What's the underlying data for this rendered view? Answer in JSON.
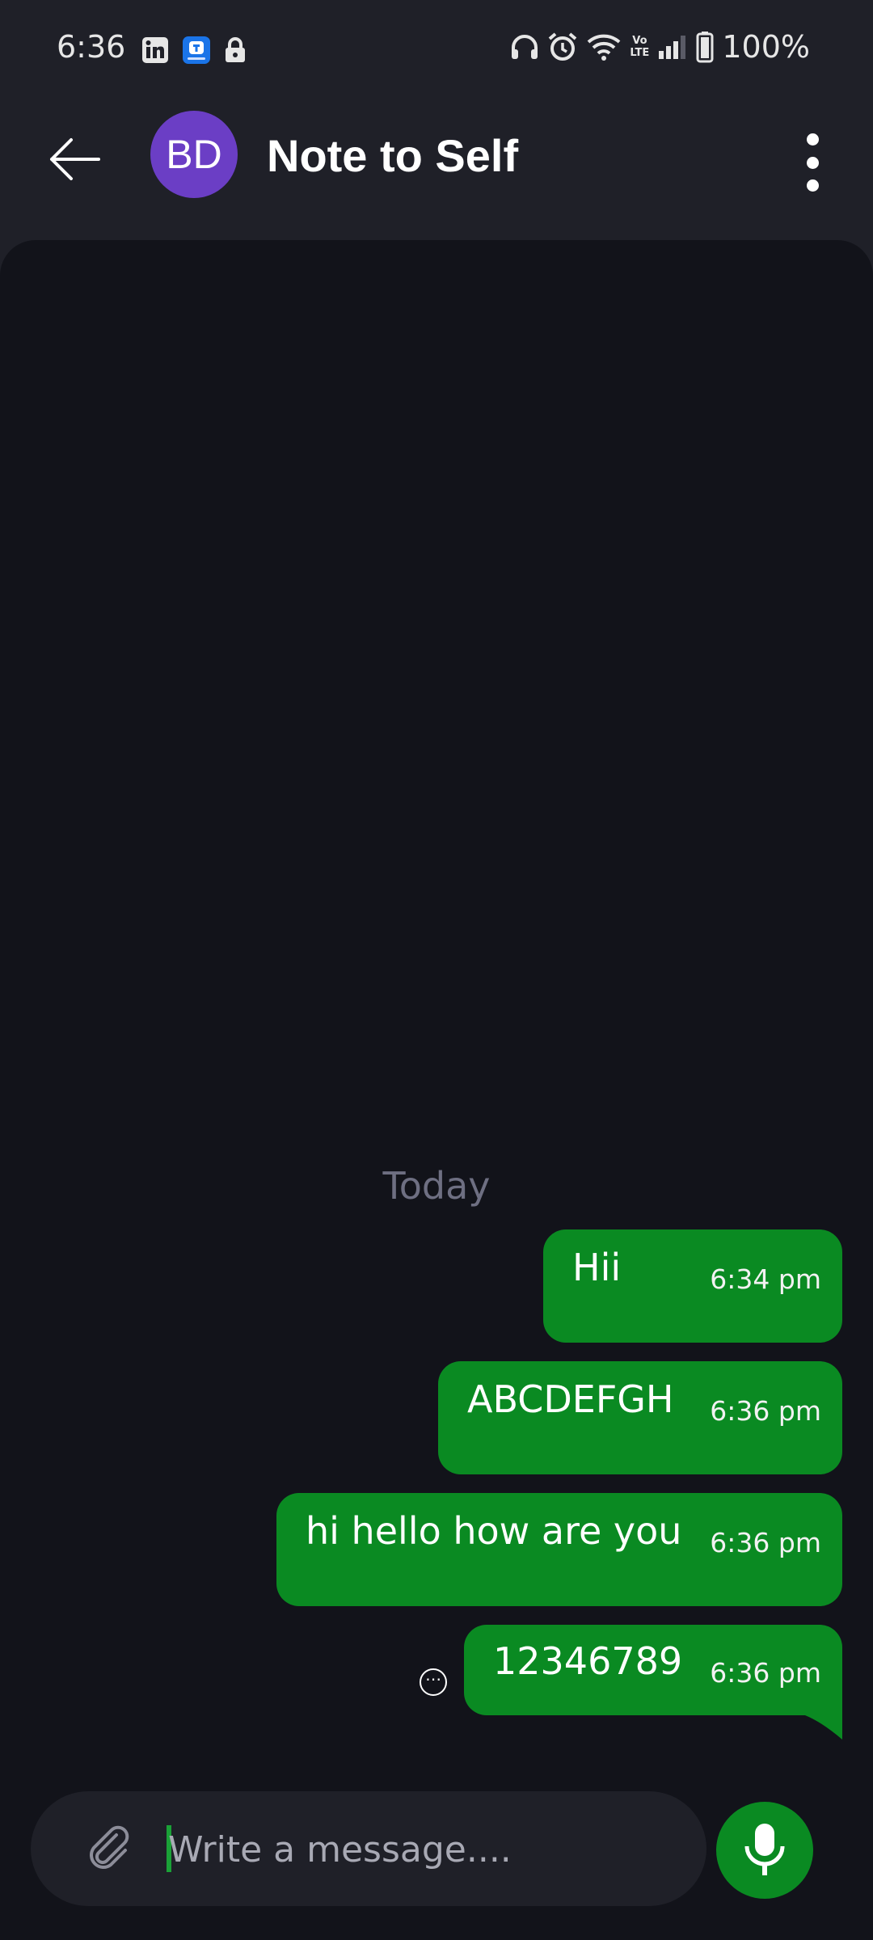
{
  "status_bar": {
    "time": "6:36",
    "battery_percent": "100%",
    "network_label": "Vo LTE"
  },
  "header": {
    "avatar_initials": "BD",
    "title": "Note to Self",
    "avatar_color": "#6b3ec5"
  },
  "chat": {
    "day_separator": "Today",
    "messages": [
      {
        "text": "Hii",
        "time": "6:34 pm"
      },
      {
        "text": "ABCDEFGH",
        "time": "6:36 pm"
      },
      {
        "text": "hi hello how are you",
        "time": "6:36 pm"
      },
      {
        "text": "12346789",
        "time": "6:36 pm"
      }
    ],
    "bubble_color": "#0a8a22"
  },
  "composer": {
    "placeholder": "Write a message...."
  },
  "icons": {
    "back": "back-arrow-icon",
    "menu": "more-vertical-icon",
    "attach": "paperclip-icon",
    "mic": "microphone-icon",
    "message_more": "more-horizontal-circle-icon"
  }
}
